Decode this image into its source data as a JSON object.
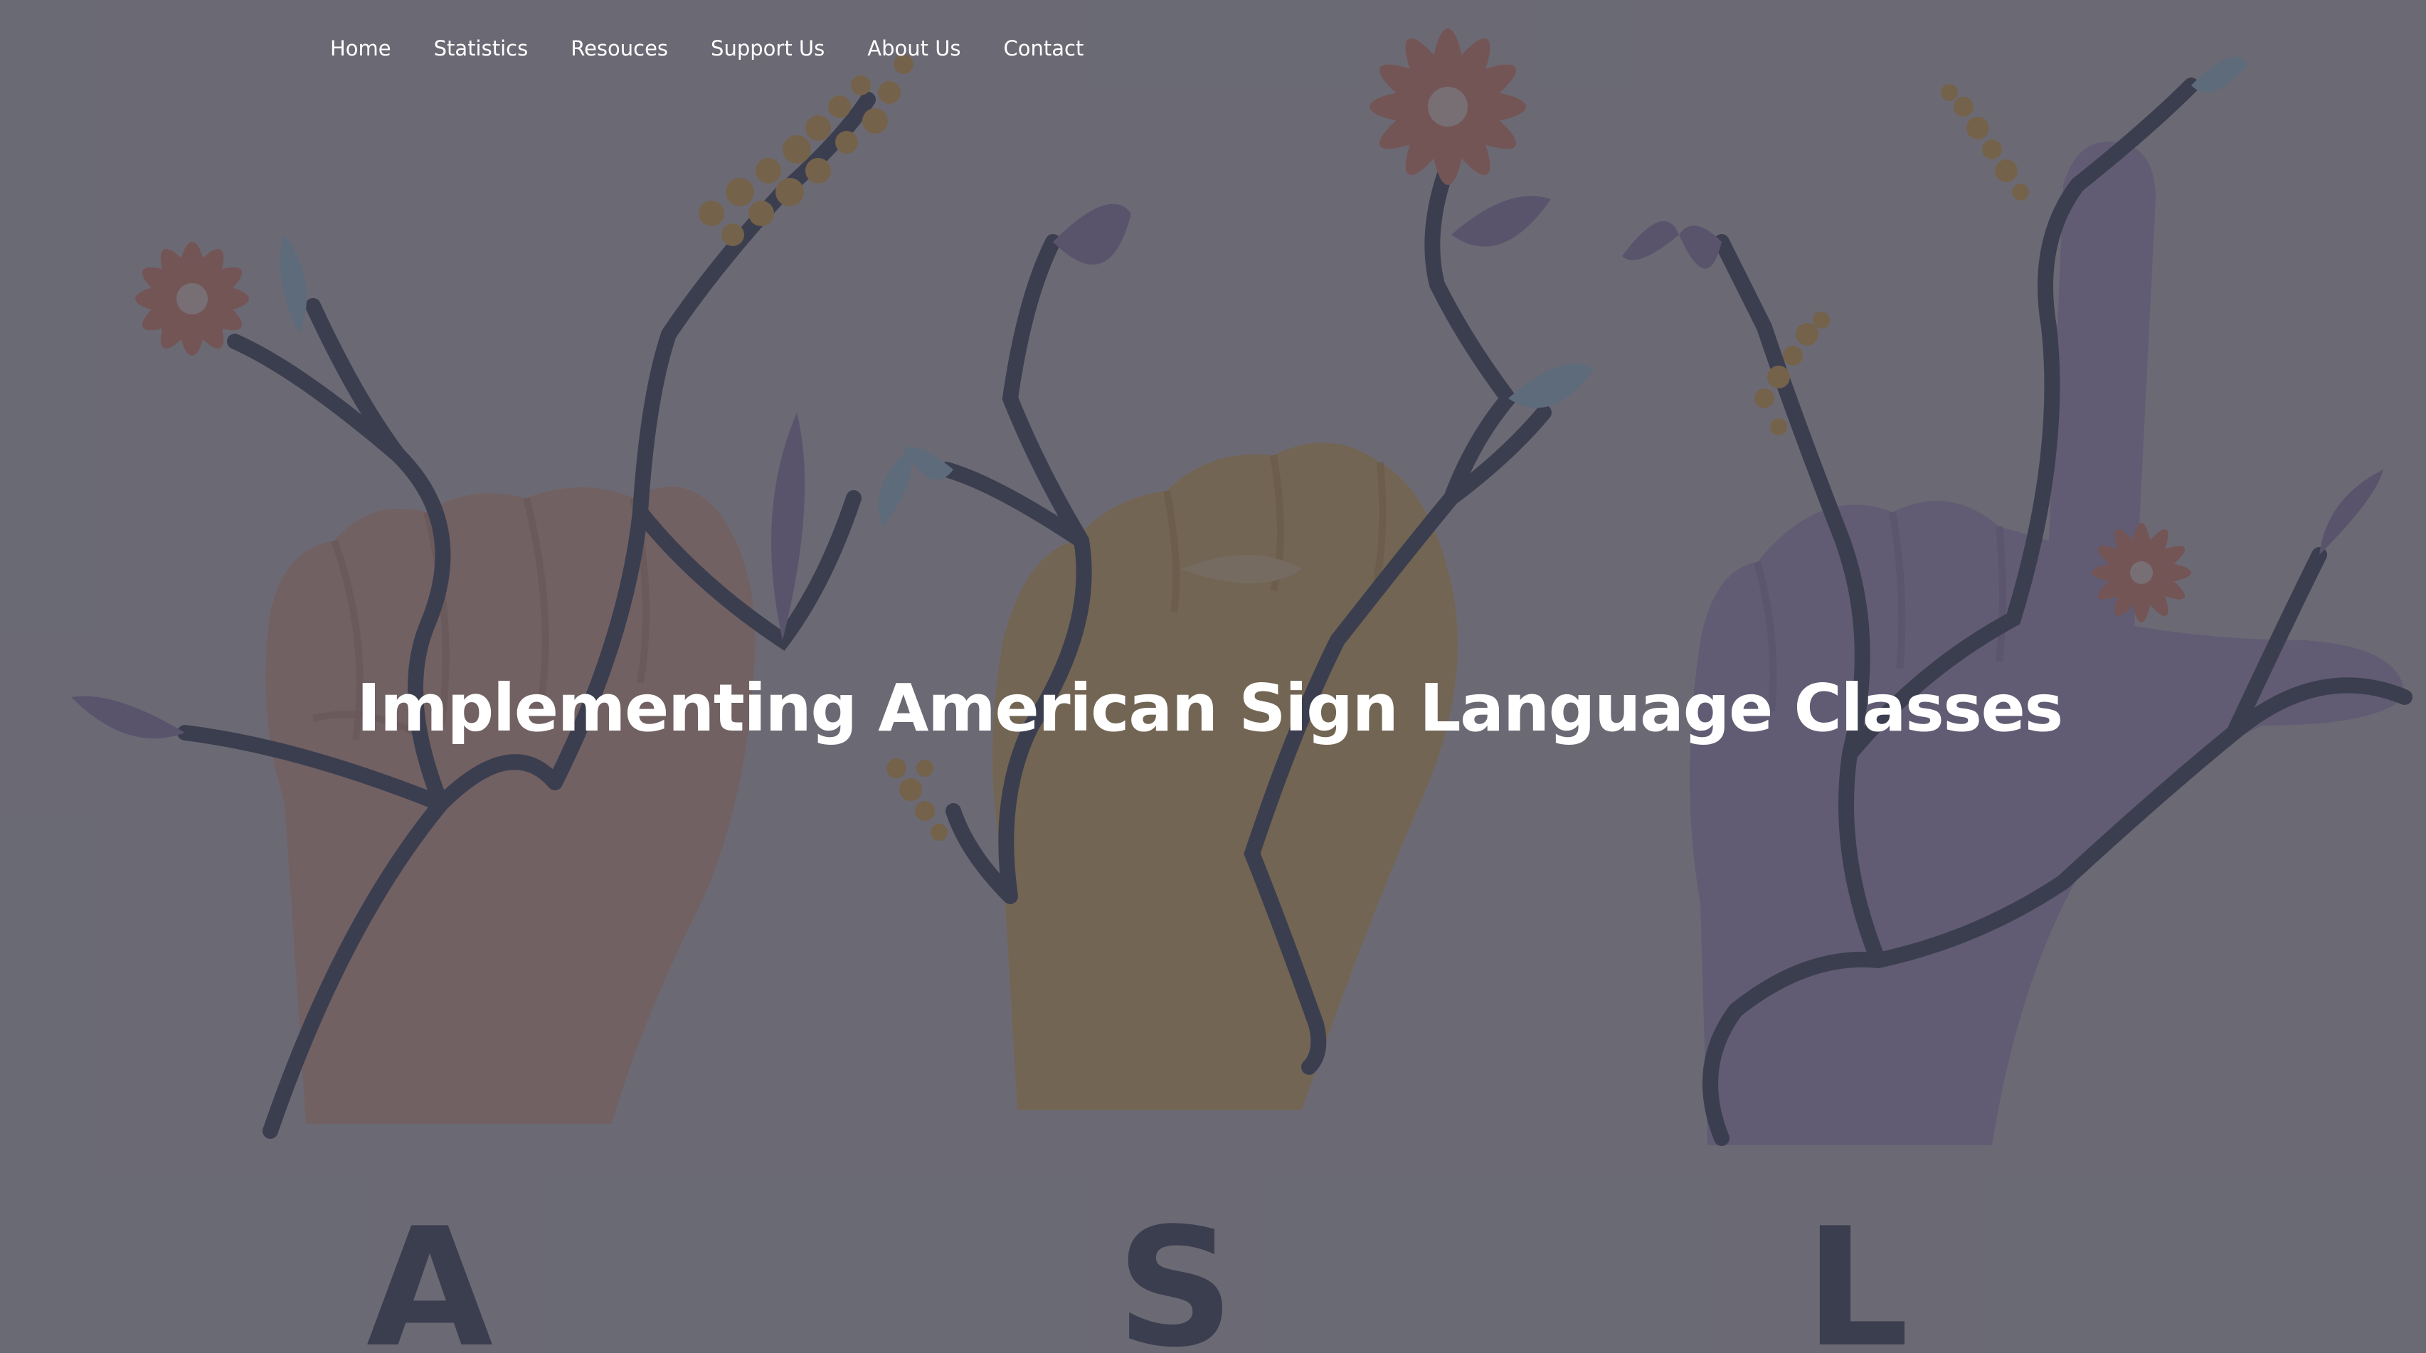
{
  "nav": {
    "items": [
      {
        "label": "Home"
      },
      {
        "label": "Statistics"
      },
      {
        "label": "Resouces"
      },
      {
        "label": "Support Us"
      },
      {
        "label": "About Us"
      },
      {
        "label": "Contact"
      }
    ]
  },
  "hero": {
    "title": "Implementing American Sign Language Classes",
    "letters": [
      "A",
      "S",
      "L"
    ],
    "overlay_color": "#46465280"
  },
  "colors": {
    "skin_light": "#e3a691",
    "skin_gold": "#e6b45a",
    "skin_purple": "#a792c8",
    "vine": "#1e2a4a",
    "flower_coral": "#e87a62",
    "mimosa": "#e8a93a",
    "leaf_blue": "#9cc9e6",
    "leaf_purple": "#8a78b0"
  }
}
